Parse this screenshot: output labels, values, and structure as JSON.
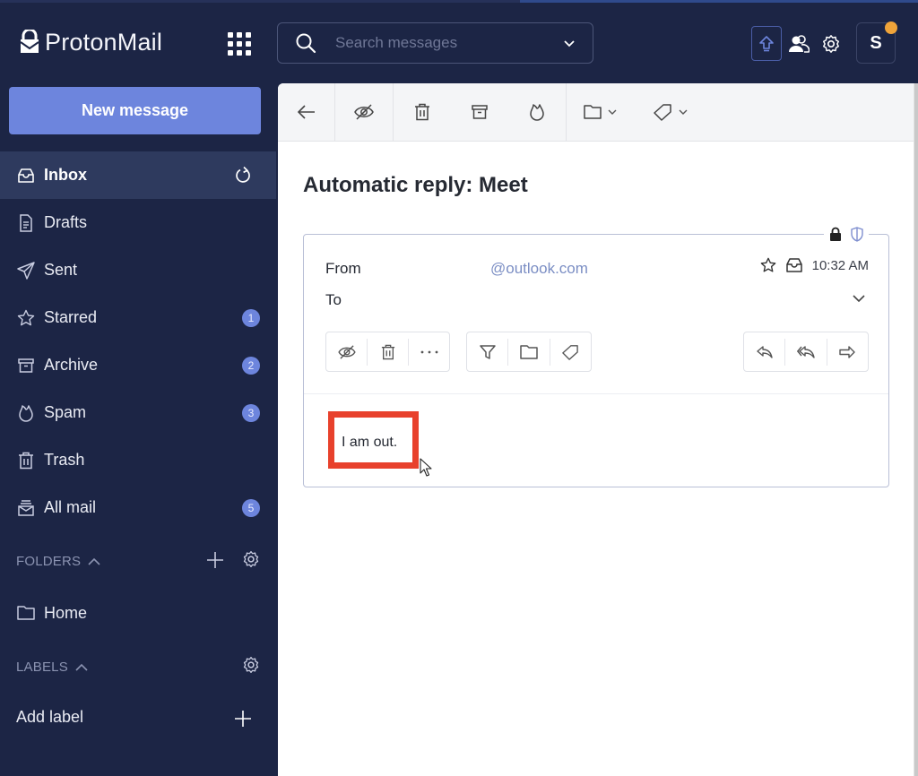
{
  "app": {
    "logo_text": "ProtonMail"
  },
  "header": {
    "search_placeholder": "Search messages",
    "search_value": "",
    "avatar_initial": "S",
    "icons": [
      "apps-grid-icon",
      "search-icon",
      "chevron-down-icon",
      "upgrade-icon",
      "contacts-icon",
      "settings-icon"
    ]
  },
  "sidebar": {
    "new_message_label": "New message",
    "items": [
      {
        "label": "Inbox",
        "icon": "inbox-icon",
        "active": true,
        "badge": null
      },
      {
        "label": "Drafts",
        "icon": "drafts-icon",
        "active": false,
        "badge": null
      },
      {
        "label": "Sent",
        "icon": "sent-icon",
        "active": false,
        "badge": null
      },
      {
        "label": "Starred",
        "icon": "star-icon",
        "active": false,
        "badge": "1"
      },
      {
        "label": "Archive",
        "icon": "archive-icon",
        "active": false,
        "badge": "2"
      },
      {
        "label": "Spam",
        "icon": "spam-icon",
        "active": false,
        "badge": "3"
      },
      {
        "label": "Trash",
        "icon": "trash-icon",
        "active": false,
        "badge": null
      },
      {
        "label": "All mail",
        "icon": "all-mail-icon",
        "active": false,
        "badge": "5"
      }
    ],
    "folders_header": "FOLDERS",
    "folders": [
      {
        "label": "Home",
        "icon": "folder-icon"
      }
    ],
    "labels_header": "LABELS",
    "add_label": "Add label"
  },
  "toolbar": {
    "buttons": [
      "back",
      "mark-unread",
      "trash",
      "archive",
      "spam",
      "move-to-folder",
      "label"
    ]
  },
  "message": {
    "subject": "Automatic reply: Meet",
    "from_label": "From",
    "from_value": "@outlook.com",
    "to_label": "To",
    "time": "10:32 AM",
    "body": "I am out."
  },
  "colors": {
    "sidebar_bg": "#1c2545",
    "accent": "#6d85dd",
    "highlight_box": "#e8412c",
    "notification_dot": "#f0a43a"
  }
}
